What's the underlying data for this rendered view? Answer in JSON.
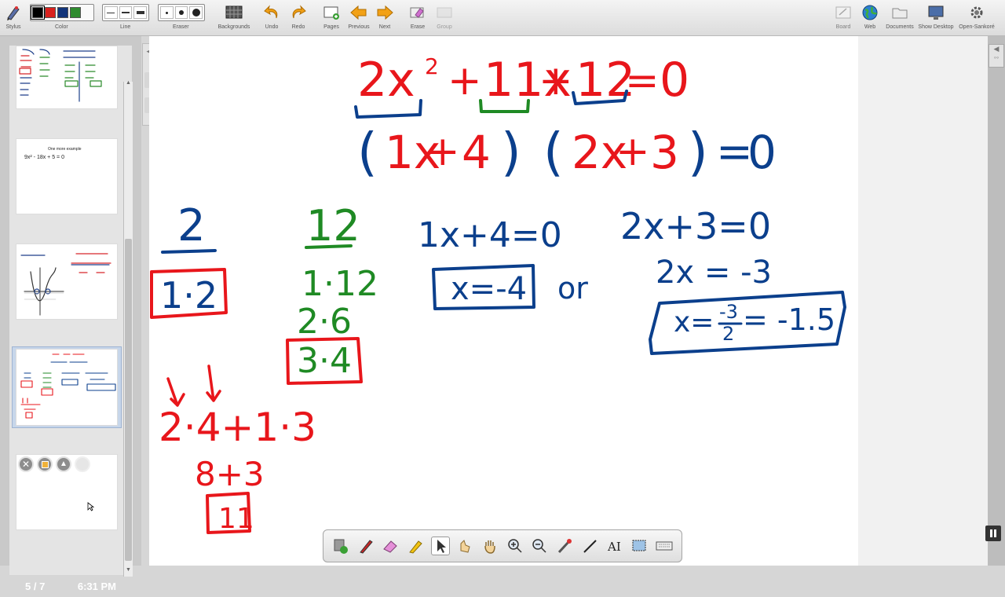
{
  "toolbar": {
    "stylus": "Stylus",
    "color": "Color",
    "line": "Line",
    "eraser": "Eraser",
    "backgrounds": "Backgrounds",
    "undo": "Undo",
    "redo": "Redo",
    "pages": "Pages",
    "previous": "Previous",
    "next": "Next",
    "erase": "Erase",
    "group": "Group",
    "board": "Board",
    "web": "Web",
    "documents": "Documents",
    "show_desktop": "Show Desktop",
    "open_sankore": "Open-Sankoré",
    "colors": [
      "#000000",
      "#d9211e",
      "#12347a",
      "#2e8b2e"
    ]
  },
  "pages_panel": {
    "page_indicator": "5 / 7",
    "clock": "6:31 PM",
    "thumb2_title": "One more example",
    "thumb2_eq": "9x² - 18x + 5 = 0"
  },
  "board": {
    "equation_parts": [
      "2x",
      "2",
      "+",
      "11x",
      "+",
      "12",
      "=",
      "0"
    ],
    "factored_left": [
      "(",
      "1x",
      "+",
      "4",
      ")"
    ],
    "factored_right": [
      "(",
      "2x",
      "+",
      "3",
      ")",
      "=",
      "0"
    ],
    "col1_header": "2",
    "col1_box": "1·2",
    "col2_header": "12",
    "col2_items": [
      "1·12",
      "2·6"
    ],
    "col2_box": "3·4",
    "eq1": "1x+4=0",
    "eq1_answer": "x=-4",
    "or_word": "or",
    "eq2": "2x+3=0",
    "eq2_step": "2x = -3",
    "eq2_answer_lhs": "x=",
    "eq2_answer_num": "-3",
    "eq2_answer_den": "2",
    "eq2_answer_rhs": "= -1.5",
    "check_line": "2·4+1·3",
    "check_sum": "8+3",
    "check_result": "11",
    "colors": {
      "red": "#e8161b",
      "blue": "#0b3f8c",
      "green": "#1f8a24"
    }
  }
}
